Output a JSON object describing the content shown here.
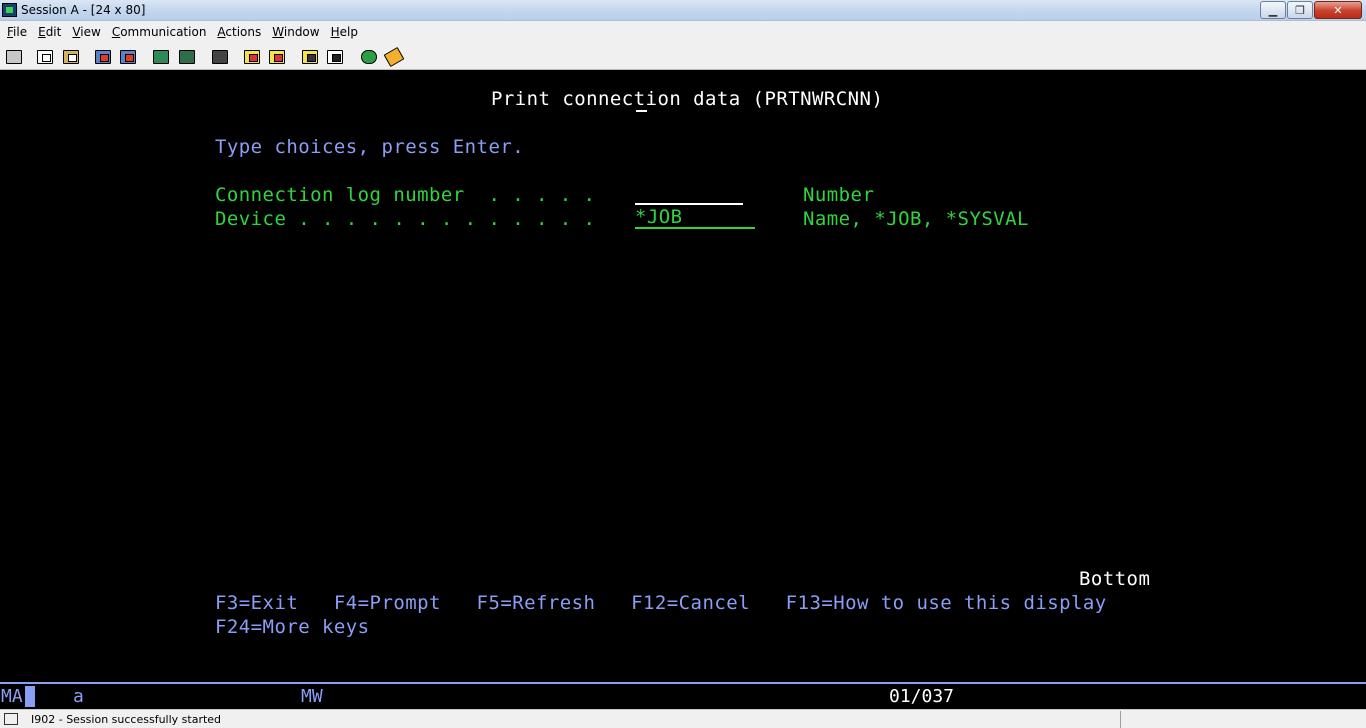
{
  "window": {
    "title": "Session A - [24 x 80]",
    "buttons": {
      "minimize": "▁",
      "maximize": "❐",
      "close": "✕"
    }
  },
  "menu": [
    {
      "label": "File",
      "ul": "F",
      "rest": "ile"
    },
    {
      "label": "Edit",
      "ul": "E",
      "rest": "dit"
    },
    {
      "label": "View",
      "ul": "V",
      "rest": "iew"
    },
    {
      "label": "Communication",
      "ul": "C",
      "rest": "ommunication"
    },
    {
      "label": "Actions",
      "ul": "A",
      "rest": "ctions"
    },
    {
      "label": "Window",
      "ul": "W",
      "rest": "indow"
    },
    {
      "label": "Help",
      "ul": "H",
      "rest": "elp"
    }
  ],
  "toolbar": {
    "icons": [
      "print-screen-icon",
      "copy-icon",
      "paste-icon",
      "send-file-icon",
      "receive-file-icon",
      "display-icon",
      "keyboard-map-icon",
      "macro-icon",
      "record-macro-icon",
      "play-macro-icon",
      "stop-macro-icon",
      "settings-icon",
      "connect-icon",
      "disconnect-icon",
      "globe-icon",
      "help-tag-icon"
    ]
  },
  "screen": {
    "title": "Print connection data (PRTNWRCNN)",
    "instructions": "Type choices, press Enter.",
    "fields": [
      {
        "label": "Connection log number  . . . . .",
        "value": "",
        "hint": "Number"
      },
      {
        "label": "Device . . . . . . . . . . . . .",
        "value": "*JOB",
        "hint": "Name, *JOB, *SYSVAL"
      }
    ],
    "position_indicator": "Bottom",
    "function_keys_line1": "F3=Exit   F4=Prompt   F5=Refresh   F12=Cancel   F13=How to use this display",
    "function_keys_line2": "F24=More keys"
  },
  "oia": {
    "mode": "MA",
    "indicator_a": "a",
    "mw": "MW",
    "cursor_position": "01/037"
  },
  "status_bar": {
    "message": "I902 - Session successfully started"
  },
  "colors": {
    "screen_bg": "#000000",
    "title_text": "#ffffff",
    "instruction_text": "#8a9ef5",
    "field_text": "#2fd53f"
  }
}
